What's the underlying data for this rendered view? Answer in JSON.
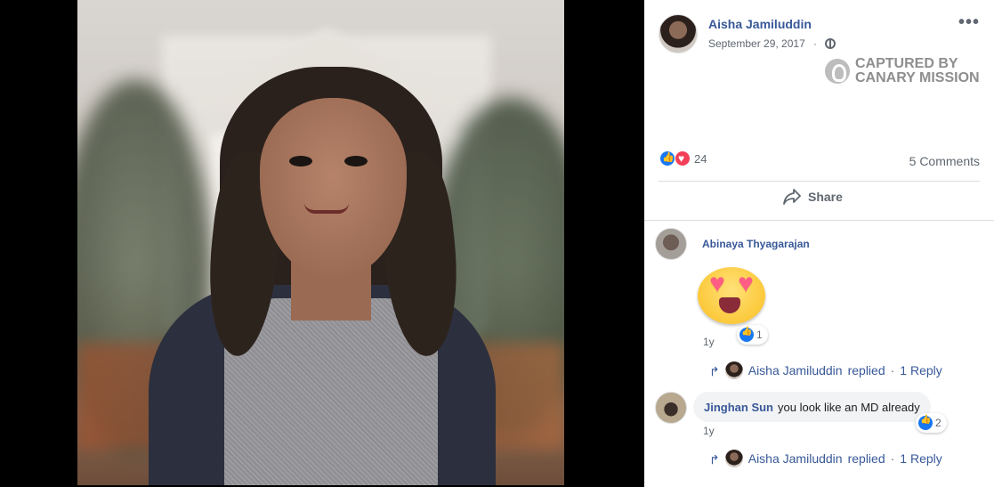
{
  "post": {
    "author": "Aisha Jamiluddin",
    "date": "September 29, 2017",
    "separator": "·",
    "more": "•••",
    "watermark_line1": "CAPTURED BY",
    "watermark_line2": "CANARY MISSION",
    "reaction_count": "24",
    "comments_count": "5 Comments",
    "share_label": "Share"
  },
  "comments": [
    {
      "author": "Abinaya Thyagarajan",
      "sticker": "heart-eyes-emoji",
      "time": "1y",
      "likes": "1",
      "replies": {
        "author": "Aisha Jamiluddin",
        "action": "replied",
        "sep": "·",
        "count_label": "1 Reply"
      }
    },
    {
      "author": "Jinghan Sun",
      "text": "you look like an MD already",
      "time": "1y",
      "likes": "2",
      "replies": {
        "author": "Aisha Jamiluddin",
        "action": "replied",
        "sep": "·",
        "count_label": "1 Reply"
      }
    }
  ],
  "icons": {
    "privacy": "globe-icon",
    "reactions": [
      "like-icon",
      "love-icon"
    ],
    "share": "share-icon",
    "reply": "reply-arrow-icon"
  },
  "colors": {
    "link": "#385898",
    "muted": "#606770",
    "like_blue": "#1877f2",
    "love_red": "#f33e58"
  }
}
